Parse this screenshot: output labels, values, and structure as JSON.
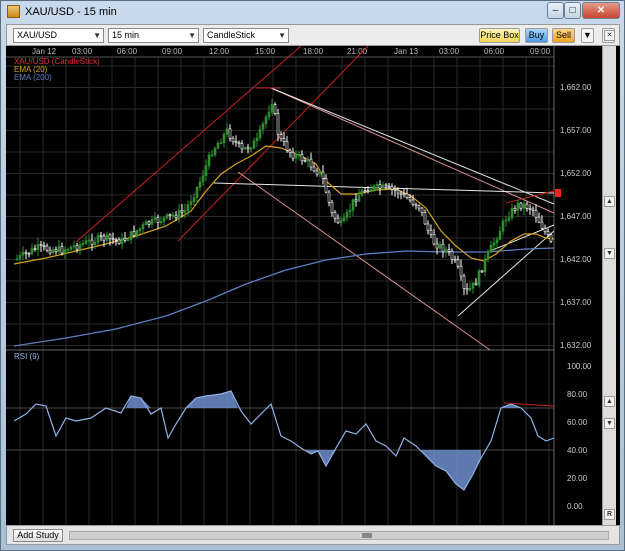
{
  "window": {
    "title": "XAU/USD - 15 min"
  },
  "toolbar": {
    "symbol": "XAU/USD",
    "timeframe": "15 min",
    "chart_style": "CandleStick",
    "price_box": "Price Box",
    "buy": "Buy",
    "sell": "Sell"
  },
  "chart": {
    "time_labels": [
      "Jan 12",
      "03:00",
      "06:00",
      "09:00",
      "12:00",
      "15:00",
      "18:00",
      "21:00",
      "Jan 13",
      "03:00",
      "06:00",
      "09:00"
    ],
    "legend": [
      "XAU/USD (CandleStick)",
      "EMA (20)",
      "EMA (200)"
    ],
    "price_ticks": [
      "1,662.00",
      "1,657.00",
      "1,652.00",
      "1,647.00",
      "1,642.00",
      "1,637.00",
      "1,632.00"
    ],
    "rsi_label": "RSI (9)",
    "rsi_ticks": [
      "100.00",
      "80.00",
      "60.00",
      "40.00",
      "20.00",
      "0.00"
    ]
  },
  "colors": {
    "up": "#2f8f2f",
    "down": "#ffffff",
    "ema20": "#d8a21c",
    "ema200": "#5d7fc2",
    "rsi": "#8fb4ea",
    "trend_red": "#c42020"
  },
  "bottom": {
    "add_study": "Add Study"
  }
}
